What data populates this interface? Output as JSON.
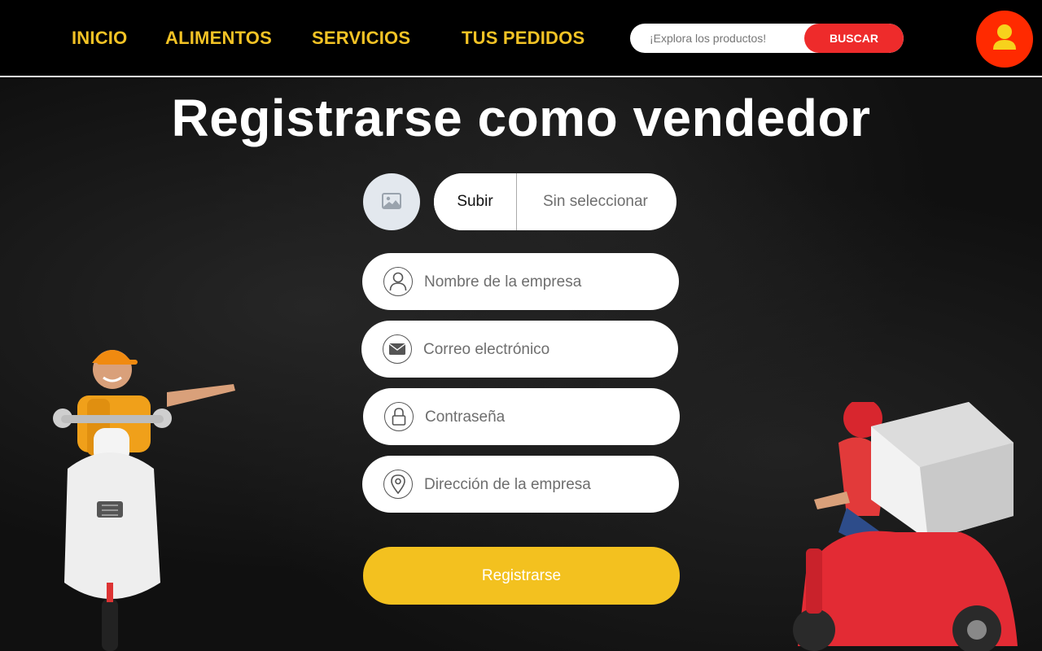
{
  "nav": {
    "items": [
      {
        "label": "INICIO"
      },
      {
        "label": "ALIMENTOS"
      },
      {
        "label": "SERVICIOS"
      },
      {
        "label": "TUS PEDIDOS"
      }
    ]
  },
  "search": {
    "placeholder": "¡Explora los productos!",
    "button_label": "BUSCAR"
  },
  "page": {
    "title": "Registrarse como vendedor"
  },
  "upload": {
    "button_label": "Subir",
    "status": "Sin seleccionar"
  },
  "form": {
    "fields": [
      {
        "placeholder": "Nombre de la empresa",
        "icon": "user-icon"
      },
      {
        "placeholder": "Correo electrónico",
        "icon": "envelope-icon"
      },
      {
        "placeholder": "Contraseña",
        "icon": "lock-icon"
      },
      {
        "placeholder": "Dirección de la empresa",
        "icon": "location-pin-icon"
      }
    ],
    "submit_label": "Registrarse"
  },
  "colors": {
    "nav_text": "#f3c325",
    "search_button": "#ee2b2b",
    "avatar_button": "#ff2a00",
    "submit_button": "#f3c11f"
  }
}
